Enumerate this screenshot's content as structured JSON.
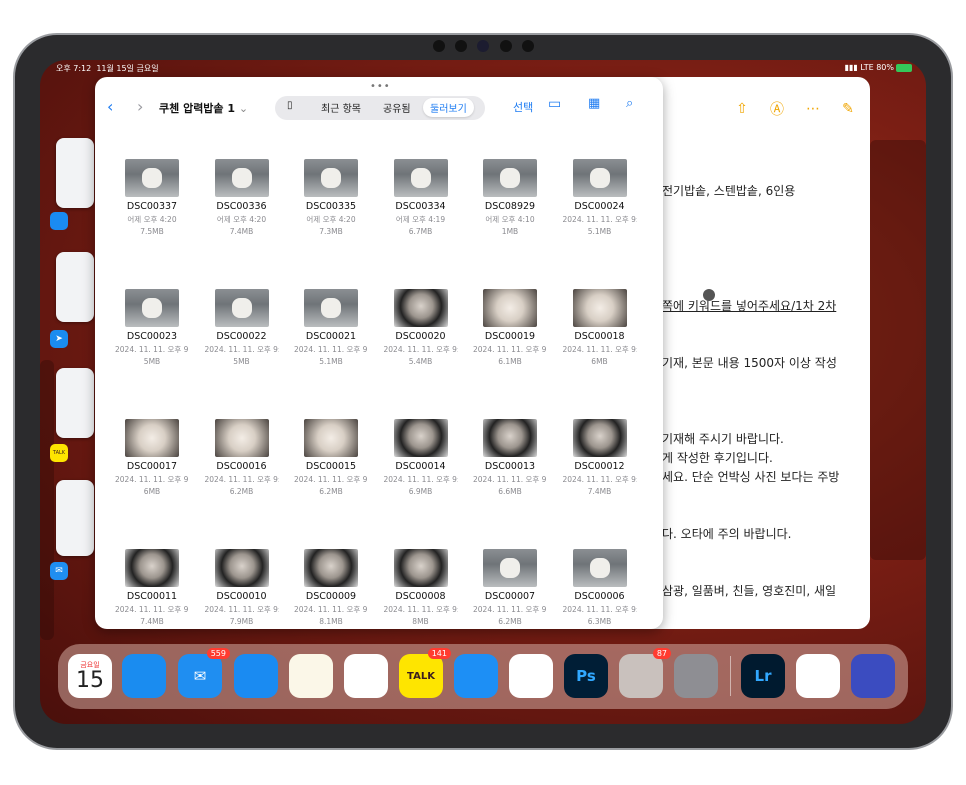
{
  "status": {
    "time": "오후 7:12",
    "date": "11월 15일 금요일",
    "network": "LTE",
    "battery": "80%"
  },
  "files": {
    "folder_title": "쿠첸 압력밥솥 1",
    "segments": [
      "최근 항목",
      "공유됨",
      "둘러보기"
    ],
    "select_label": "선택",
    "items": [
      {
        "name": "DSC00337",
        "date": "어제 오후 4:20",
        "size": "7.5MB",
        "kind": "cooker"
      },
      {
        "name": "DSC00336",
        "date": "어제 오후 4:20",
        "size": "7.4MB",
        "kind": "cooker"
      },
      {
        "name": "DSC00335",
        "date": "어제 오후 4:20",
        "size": "7.3MB",
        "kind": "cooker"
      },
      {
        "name": "DSC00334",
        "date": "어제 오후 4:19",
        "size": "6.7MB",
        "kind": "cooker"
      },
      {
        "name": "DSC08929",
        "date": "어제 오후 4:10",
        "size": "1MB",
        "kind": "cooker"
      },
      {
        "name": "DSC00024",
        "date": "2024. 11. 11. 오후 9:...",
        "size": "5.1MB",
        "kind": "cooker"
      },
      {
        "name": "DSC00023",
        "date": "2024. 11. 11. 오후 9:51",
        "size": "5MB",
        "kind": "cooker"
      },
      {
        "name": "DSC00022",
        "date": "2024. 11. 11. 오후 9:...",
        "size": "5MB",
        "kind": "cooker"
      },
      {
        "name": "DSC00021",
        "date": "2024. 11. 11. 오후 9:...",
        "size": "5.1MB",
        "kind": "cooker"
      },
      {
        "name": "DSC00020",
        "date": "2024. 11. 11. 오후 9:...",
        "size": "5.4MB",
        "kind": "pot"
      },
      {
        "name": "DSC00019",
        "date": "2024. 11. 11. 오후 9:...",
        "size": "6.1MB",
        "kind": "rice"
      },
      {
        "name": "DSC00018",
        "date": "2024. 11. 11. 오후 9:...",
        "size": "6MB",
        "kind": "rice"
      },
      {
        "name": "DSC00017",
        "date": "2024. 11. 11. 오후 9:...",
        "size": "6MB",
        "kind": "rice"
      },
      {
        "name": "DSC00016",
        "date": "2024. 11. 11. 오후 9:...",
        "size": "6.2MB",
        "kind": "rice"
      },
      {
        "name": "DSC00015",
        "date": "2024. 11. 11. 오후 9:...",
        "size": "6.2MB",
        "kind": "rice"
      },
      {
        "name": "DSC00014",
        "date": "2024. 11. 11. 오후 9:...",
        "size": "6.9MB",
        "kind": "pot"
      },
      {
        "name": "DSC00013",
        "date": "2024. 11. 11. 오후 9:...",
        "size": "6.6MB",
        "kind": "pot"
      },
      {
        "name": "DSC00012",
        "date": "2024. 11. 11. 오후 9:51",
        "size": "7.4MB",
        "kind": "pot"
      },
      {
        "name": "DSC00011",
        "date": "2024. 11. 11. 오후 9:51",
        "size": "7.4MB",
        "kind": "pot"
      },
      {
        "name": "DSC00010",
        "date": "2024. 11. 11. 오후 9:...",
        "size": "7.9MB",
        "kind": "pot"
      },
      {
        "name": "DSC00009",
        "date": "2024. 11. 11. 오후 9:...",
        "size": "8.1MB",
        "kind": "pot"
      },
      {
        "name": "DSC00008",
        "date": "2024. 11. 11. 오후 9:...",
        "size": "8MB",
        "kind": "pot"
      },
      {
        "name": "DSC00007",
        "date": "2024. 11. 11. 오후 9:...",
        "size": "6.2MB",
        "kind": "cooker"
      },
      {
        "name": "DSC00006",
        "date": "2024. 11. 11. 오후 9:...",
        "size": "6.3MB",
        "kind": "cooker"
      }
    ]
  },
  "notes": {
    "lines": [
      {
        "text": "전기밥솥, 스텐밥솥, 6인용",
        "underline": false
      },
      {
        "text": "쪽에 키워드를 넣어주세요/1차 2차",
        "underline": true
      },
      {
        "text": "기재, 본문 내용 1500자 이상 작성",
        "underline": false
      },
      {
        "text": "기재해 주시기 바랍니다.",
        "underline": false
      },
      {
        "text": "게 작성한 후기입니다.",
        "underline": false
      },
      {
        "text": "세요. 단순 언박싱 사진 보다는 주방",
        "underline": false
      },
      {
        "text": "다. 오타에 주의 바랍니다.",
        "underline": false
      },
      {
        "text": "삼광, 일품벼, 친들, 영호진미, 새일",
        "underline": false
      }
    ]
  },
  "dock": {
    "calendar": {
      "weekday": "금요일",
      "day": "15"
    },
    "apps": [
      {
        "name": "safari",
        "label": "",
        "color": "#1a8cf0",
        "badge": ""
      },
      {
        "name": "mail",
        "label": "✉",
        "color": "#1f8ef1",
        "badge": "559"
      },
      {
        "name": "files",
        "label": "",
        "color": "#1a8bf2",
        "badge": ""
      },
      {
        "name": "notes",
        "label": "",
        "color": "#fbf7e8",
        "badge": ""
      },
      {
        "name": "photos",
        "label": "",
        "color": "#ffffff",
        "badge": ""
      },
      {
        "name": "kakaotalk",
        "label": "TALK",
        "color": "#fee500",
        "badge": "141"
      },
      {
        "name": "keynote",
        "label": "",
        "color": "#1d8ff5",
        "badge": ""
      },
      {
        "name": "chatgpt",
        "label": "",
        "color": "#ffffff",
        "badge": ""
      },
      {
        "name": "photoshop",
        "label": "Ps",
        "color": "#001e36",
        "badge": ""
      },
      {
        "name": "app-library",
        "label": "",
        "color": "#c9c1bd",
        "badge": "87"
      },
      {
        "name": "settings",
        "label": "",
        "color": "#8e8e93",
        "badge": ""
      },
      {
        "name": "lightroom",
        "label": "Lr",
        "color": "#001a2f",
        "badge": ""
      },
      {
        "name": "chrome",
        "label": "",
        "color": "#ffffff",
        "badge": ""
      },
      {
        "name": "shortcuts",
        "label": "",
        "color": "#3b4cc0",
        "badge": ""
      }
    ]
  },
  "colors": {
    "accent": "#1e7cf2",
    "notes_accent": "#f0a500",
    "badge": "#ff3b30"
  }
}
